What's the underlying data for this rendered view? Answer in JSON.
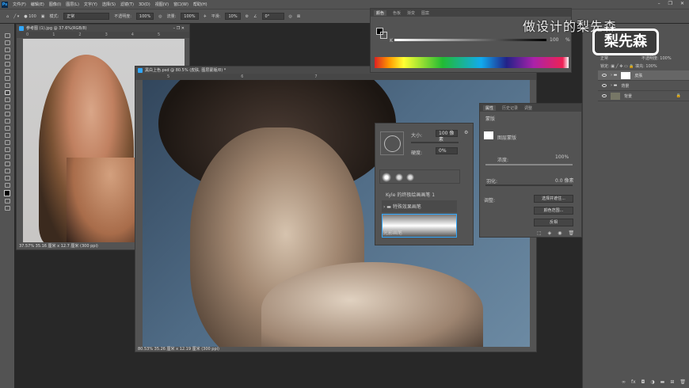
{
  "menubar": {
    "items": [
      "文件(F)",
      "编辑(E)",
      "图像(I)",
      "图层(L)",
      "文字(Y)",
      "选择(S)",
      "滤镜(T)",
      "3D(D)",
      "视图(V)",
      "窗口(W)",
      "帮助(H)"
    ]
  },
  "options": {
    "brush_size": "100",
    "mode_label": "模式:",
    "mode_value": "正常",
    "opacity_label": "不透明度:",
    "opacity_value": "100%",
    "flow_label": "流量:",
    "flow_value": "100%",
    "smooth_label": "平滑:",
    "smooth_value": "10%",
    "angle_value": "0°"
  },
  "doc1": {
    "title": "参考图 (1).jpg @ 37.6%(RGB/8)",
    "ruler": [
      "0",
      "1",
      "2",
      "3",
      "4",
      "5",
      "6",
      "7",
      "8",
      "9"
    ],
    "status": "37.57%   35.16 厘米 x 12.7 厘米 (300 ppi)"
  },
  "doc2": {
    "title": "黑白上色.psd @ 80.5% (皮肤, 图层蒙版/8) *",
    "ruler": [
      "5",
      "6",
      "7"
    ],
    "status": "80.53%   35.26 厘米 x 12.19 厘米 (300 ppi)"
  },
  "color_panel": {
    "tabs": [
      "颜色",
      "色板",
      "渐变",
      "图案"
    ],
    "channel": "K",
    "value": "100",
    "unit": "%"
  },
  "brush_panel": {
    "size_label": "大小:",
    "size_value": "100 像素",
    "hardness_label": "硬度:",
    "hardness_value": "0%",
    "group1": "Kyle 的终极绘画画笔 1",
    "group2": "特殊效果画笔",
    "selected_brush": "光影画笔"
  },
  "properties_panel": {
    "tabs": [
      "属性",
      "历史记录",
      "调整"
    ],
    "mask_label": "蒙版",
    "layer_mask": "图层蒙版",
    "density_label": "浓度:",
    "density_value": "100%",
    "feather_label": "羽化:",
    "feather_value": "0.0 像素",
    "refine_label": "调整:",
    "buttons": [
      "选择并遮住...",
      "颜色范围...",
      "反相"
    ]
  },
  "layers_panel": {
    "blend": "正常",
    "opacity_label": "不透明度:",
    "opacity_value": "100%",
    "lock_label": "锁定:",
    "fill_label": "填充:",
    "fill_value": "100%",
    "layers": [
      {
        "name": "皮肤",
        "type": "group-mask"
      },
      {
        "name": "背景",
        "type": "group"
      },
      {
        "name": "背景",
        "type": "image",
        "locked": true
      }
    ]
  },
  "watermark": {
    "text": "做设计的梨先森",
    "logo": "梨先森"
  },
  "colors": {
    "bg": "#282828",
    "panel": "#535353",
    "accent": "#31a8ff"
  }
}
